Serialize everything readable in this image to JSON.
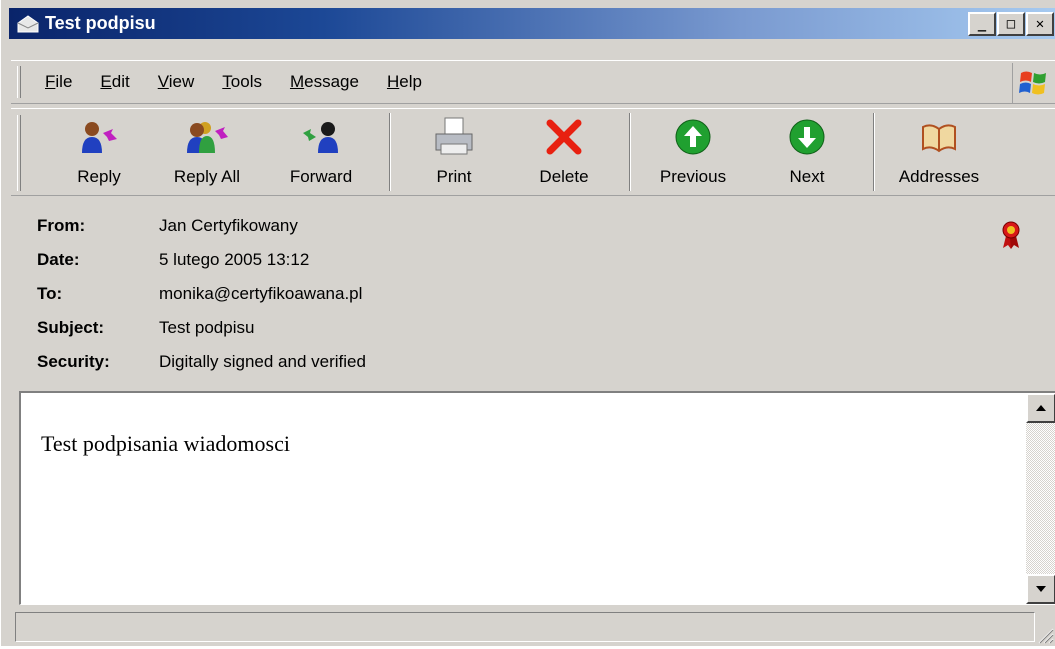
{
  "window": {
    "title": "Test podpisu"
  },
  "menu": [
    {
      "label_ul": "F",
      "label_rest": "ile"
    },
    {
      "label_ul": "E",
      "label_rest": "dit"
    },
    {
      "label_ul": "V",
      "label_rest": "iew"
    },
    {
      "label_ul": "T",
      "label_rest": "ools"
    },
    {
      "label_ul": "M",
      "label_rest": "essage"
    },
    {
      "label_ul": "H",
      "label_rest": "elp"
    }
  ],
  "toolbar": {
    "reply": "Reply",
    "reply_all": "Reply All",
    "forward": "Forward",
    "print": "Print",
    "delete": "Delete",
    "previous": "Previous",
    "next": "Next",
    "addresses": "Addresses"
  },
  "header": {
    "from_label": "From:",
    "from": "Jan Certyfikowany",
    "date_label": "Date:",
    "date": "5 lutego 2005 13:12",
    "to_label": "To:",
    "to": "monika@certyfikoawana.pl",
    "subject_label": "Subject:",
    "subject": "Test podpisu",
    "security_label": "Security:",
    "security": "Digitally signed and verified"
  },
  "body": {
    "text": "Test podpisania wiadomosci"
  },
  "colors": {
    "titlebar_start": "#0a246a",
    "titlebar_end": "#a6caf0",
    "chrome": "#d6d3ce"
  },
  "icons": [
    "envelope-icon",
    "windows-logo-icon",
    "reply-icon",
    "reply-all-icon",
    "forward-icon",
    "print-icon",
    "delete-icon",
    "previous-icon",
    "next-icon",
    "addresses-icon",
    "signature-seal-icon"
  ]
}
